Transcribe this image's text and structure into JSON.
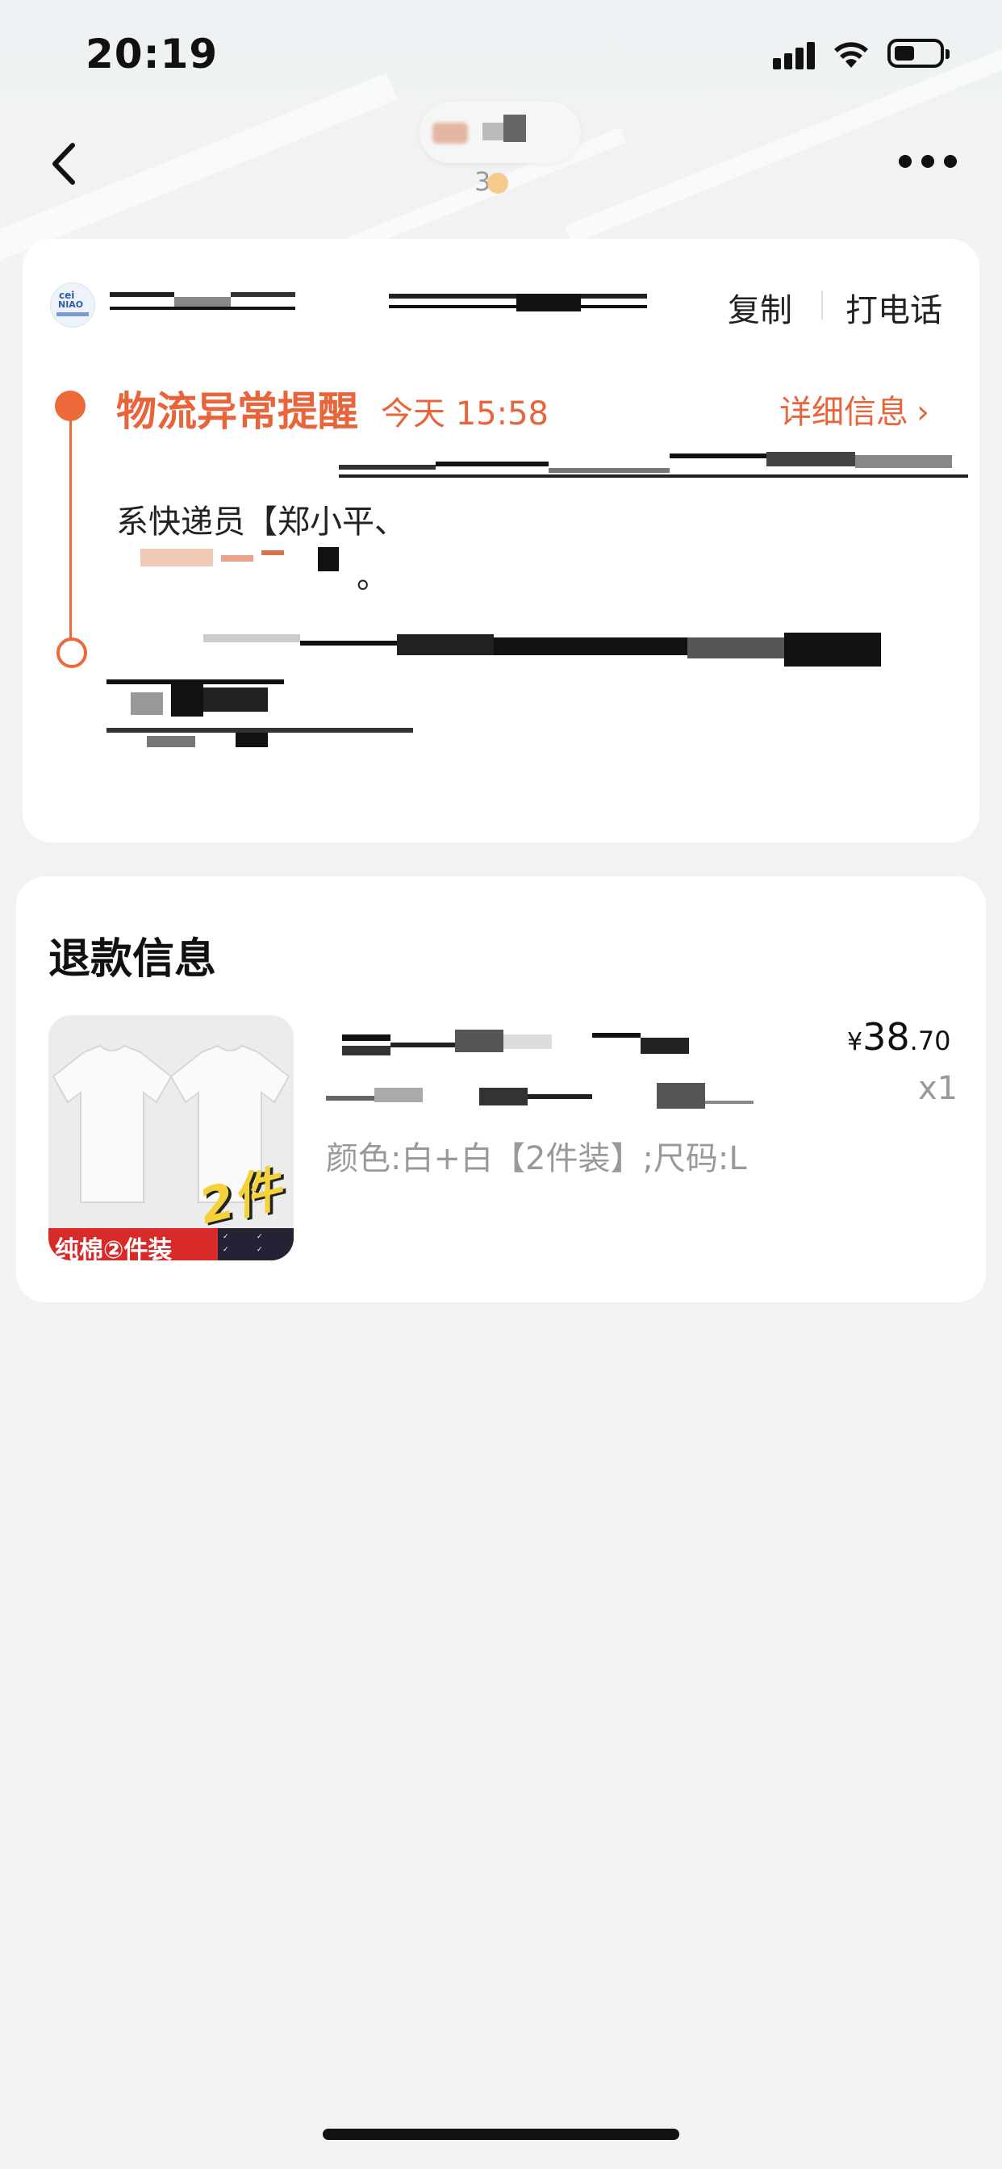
{
  "status_bar": {
    "time": "20:19"
  },
  "header": {
    "subtitle": "3"
  },
  "logistics": {
    "actions": {
      "copy": "复制",
      "call": "打电话"
    },
    "alert": {
      "title": "物流异常提醒",
      "time": "今天 15:58",
      "detail_link": "详细信息"
    },
    "courier_text": "系快递员【郑小平、",
    "period": "。"
  },
  "refund": {
    "section_title": "退款信息",
    "product": {
      "image_banner": "纯棉②件装",
      "image_badge": "2件",
      "price_symbol": "¥",
      "price_main": "38",
      "price_cents": ".70",
      "quantity": "x1",
      "spec": "颜色:白+白【2件装】;尺码:L"
    }
  },
  "icons": {
    "back": "chevron-left-icon",
    "more": "more-dots-icon",
    "signal": "cellular-signal-icon",
    "wifi": "wifi-icon",
    "battery": "battery-icon",
    "detail": "chevron-right-icon"
  },
  "colors": {
    "accent": "#e8643a",
    "background": "#f2f2f2",
    "card": "#ffffff"
  }
}
